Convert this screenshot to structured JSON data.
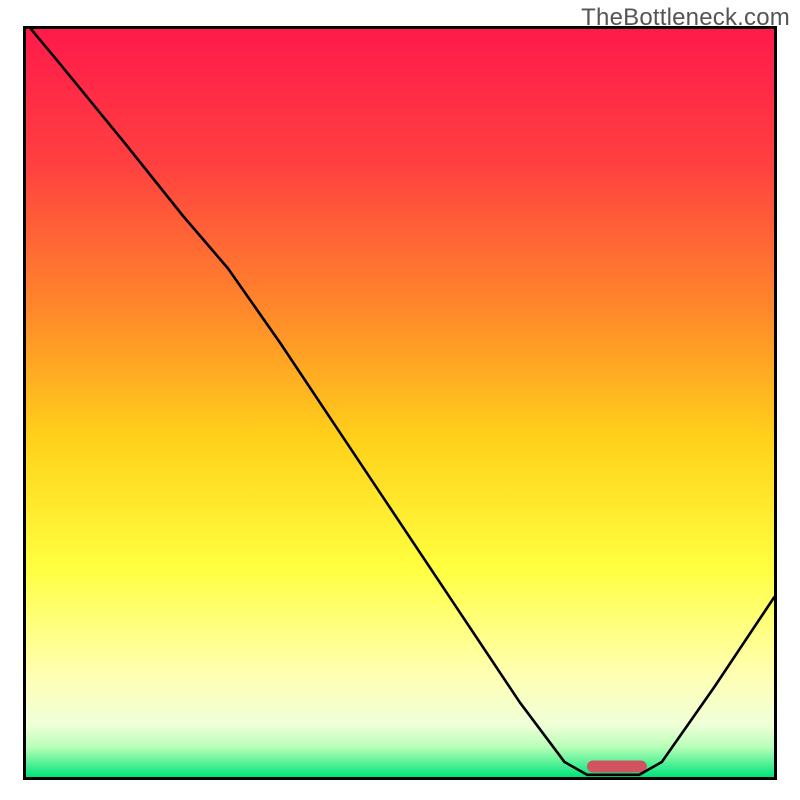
{
  "watermark": "TheBottleneck.com",
  "chart_data": {
    "type": "line",
    "title": "",
    "xlabel": "",
    "ylabel": "",
    "xlim": [
      0,
      100
    ],
    "ylim": [
      0,
      100
    ],
    "gradient_stops": [
      {
        "offset": 0,
        "color": "#ff1a4b"
      },
      {
        "offset": 18,
        "color": "#ff4040"
      },
      {
        "offset": 38,
        "color": "#ff8a2a"
      },
      {
        "offset": 55,
        "color": "#ffd21a"
      },
      {
        "offset": 72,
        "color": "#ffff40"
      },
      {
        "offset": 86,
        "color": "#ffffb0"
      },
      {
        "offset": 93,
        "color": "#f0ffd8"
      },
      {
        "offset": 96,
        "color": "#b8ffb8"
      },
      {
        "offset": 100,
        "color": "#00e47a"
      }
    ],
    "curve_points": [
      {
        "x": 0.0,
        "y": 100.8
      },
      {
        "x": 4.0,
        "y": 96.0
      },
      {
        "x": 13.0,
        "y": 85.0
      },
      {
        "x": 21.0,
        "y": 75.0
      },
      {
        "x": 27.0,
        "y": 68.0
      },
      {
        "x": 34.0,
        "y": 58.0
      },
      {
        "x": 42.0,
        "y": 46.0
      },
      {
        "x": 50.0,
        "y": 34.0
      },
      {
        "x": 58.0,
        "y": 22.0
      },
      {
        "x": 66.0,
        "y": 10.0
      },
      {
        "x": 72.0,
        "y": 2.0
      },
      {
        "x": 75.0,
        "y": 0.3
      },
      {
        "x": 82.0,
        "y": 0.3
      },
      {
        "x": 85.0,
        "y": 2.0
      },
      {
        "x": 92.0,
        "y": 12.0
      },
      {
        "x": 100.0,
        "y": 24.0
      }
    ],
    "marker": {
      "x_start": 75,
      "x_end": 83,
      "y": 0.6,
      "color": "#d0535f",
      "height": 1.6
    }
  }
}
